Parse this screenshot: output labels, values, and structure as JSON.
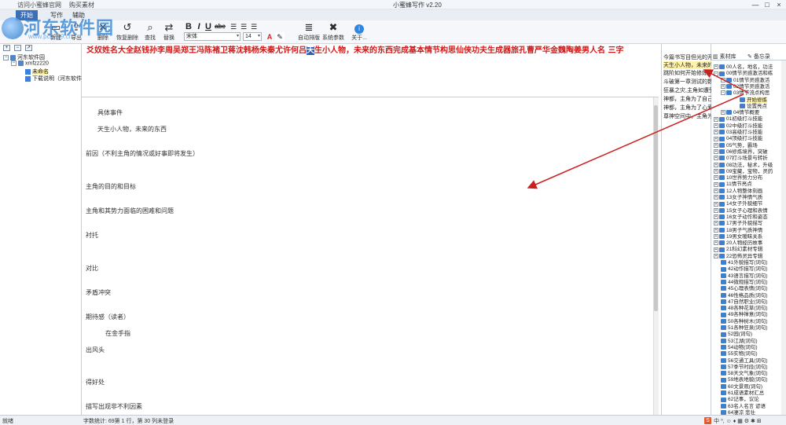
{
  "window": {
    "title": "小蜜蜂写作 v2.20",
    "links": [
      "访问小蜜蜂官网",
      "购买素材"
    ],
    "controls": [
      "—",
      "□",
      "×"
    ]
  },
  "logo": {
    "text": "河东软件园",
    "url": "www.pc0359.cn"
  },
  "ribbon": {
    "tabs": [
      "开始",
      "写作",
      "辅助"
    ],
    "buttons": [
      {
        "label": "新建",
        "icon": "new-icon"
      },
      {
        "label": "导出",
        "icon": "export-icon"
      },
      {
        "label": "删除",
        "icon": "delete-icon"
      },
      {
        "label": "恢复删除",
        "icon": "restore-icon"
      },
      {
        "label": "查找",
        "icon": "find-icon"
      },
      {
        "label": "替换",
        "icon": "replace-icon"
      },
      {
        "label": "自动排版",
        "icon": "auto-format-icon"
      },
      {
        "label": "系统参数",
        "icon": "settings-icon"
      },
      {
        "label": "关于...",
        "icon": "info-icon"
      }
    ],
    "format": {
      "bold": "B",
      "italic": "I",
      "underline": "U",
      "strike": "abc"
    },
    "font_name": "宋体",
    "font_size": "14"
  },
  "left_tree": {
    "root": "河东软件园",
    "child": "xmfzz220",
    "items": [
      "未命名",
      "下载说明（河东软件园）"
    ]
  },
  "outline": {
    "before": "爻奴姓名大全赵钱孙李周吴郑王冯陈褚卫蒋沈韩杨朱秦尤许何吕",
    "highlight": "天",
    "after": "生小人物，未来的东西完成基本情节构思仙侠功夫生成器旅孔曹严华金魏陶姜男人名  三字"
  },
  "editor": {
    "lines": [
      "具体事件",
      "天生小人物，未来的东西",
      "前因（不利主角的情况或好事即将发生）",
      "主角的目的和目标",
      "主角和其势力面临的困难和问题",
      "衬托",
      "对比",
      "矛盾冲突",
      "期待感（读者）",
      "在金手指",
      "出风头",
      "得好处",
      "描写出观非不利因素"
    ]
  },
  "right_list": {
    "items": [
      "今篇书写目但光的开往",
      "天生小人物，未来的东西",
      "跳阶如何开始修炼",
      "斗破第一章测试的数据",
      "狂暴之灾,主角如遭受",
      "神都，主角为了自己而",
      "神都，主角为了心爱的",
      "尊神空间中，主角为了"
    ]
  },
  "material": {
    "tabs": [
      "素材库",
      "备忘录"
    ],
    "nodes": [
      "00人名，地名，功法",
      "00情节灵感激活和练",
      "01情节灵感激活",
      "02情节灵感激活",
      "03情节流点构思",
      "开始修炼",
      "设置亮点",
      "04情节概要",
      "01初级打斗技能",
      "02中级打斗技能",
      "03高级打斗技能",
      "04顶级打斗技能",
      "05气势，霸场",
      "06修炼境界，突破",
      "07打斗场景与转折",
      "08功法，秘术，升级",
      "09宝藏，宝物，灵药",
      "10世界势力分布",
      "11情节亮点",
      "12人物整体刻画",
      "13女子神情气质",
      "14女子外貌细节",
      "15女子心理和表情",
      "16女子动作和姿态",
      "17男子外貌描写",
      "18男子气质神情",
      "19男女暧昧关系",
      "20人物经历故事",
      "21科幻素材专辑",
      "22恐怖灵异专辑",
      "41外貌描写(词句)",
      "42动作描写(词句)",
      "43语言描写(词句)",
      "44微观描写(词句)",
      "45心理表情(词句)",
      "46性格品质(词句)",
      "47自然职业(词句)",
      "48各种花草(词句)",
      "49各种禅意(词句)",
      "50各种树木(词句)",
      "51各种狂泉(词句)",
      "52园(词句)",
      "53江湖(词句)",
      "54动物(词句)",
      "55实物(词句)",
      "56交通工具(词句)",
      "57季节时段(词句)",
      "58天文气象(词句)",
      "59地表地貌(词句)",
      "60文景观(词句)",
      "61成语素材汇总",
      "62记事，议论",
      "63名人名言 谚语",
      "64凄凉 悲壮"
    ]
  },
  "status": {
    "left": "就绪",
    "info": "字数统计: 69第 1 行，第 30 列未登录"
  },
  "colors": {
    "accent": "#3a6fb8",
    "outline_red": "#d21818",
    "arrow": "#cc1f1f"
  }
}
